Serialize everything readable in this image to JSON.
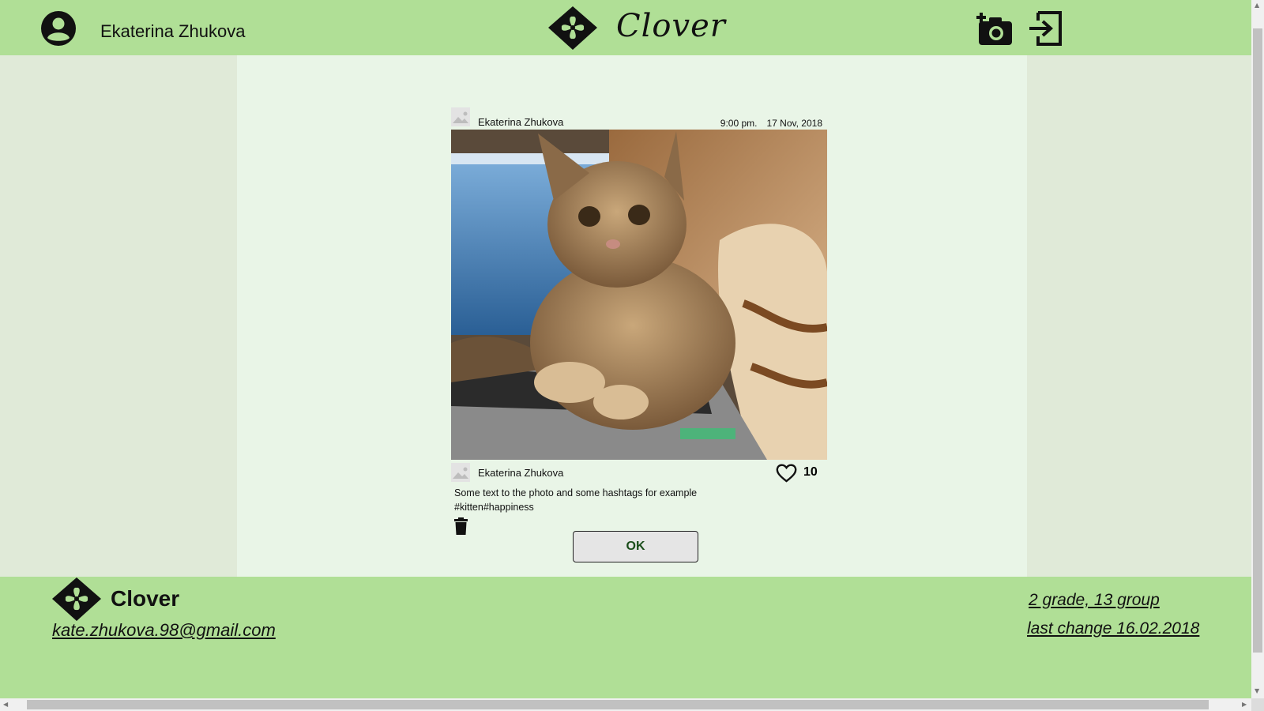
{
  "header": {
    "user_name": "Ekaterina Zhukova",
    "app_title": "Clover"
  },
  "post": {
    "author": "Ekaterina Zhukova",
    "time": "9:00 pm.",
    "date": "17 Nov, 2018",
    "likes": "10",
    "caption_line1": "Some text to the photo and some hashtags for example",
    "caption_line2": "#kitten#happiness",
    "ok_label": "OK"
  },
  "footer": {
    "brand": "Clover",
    "email": "kate.zhukova.98@gmail.com",
    "grade": "2 grade, 13 group",
    "last_change": "last change 16.02.2018"
  },
  "colors": {
    "header_bg": "#b0df96",
    "content_bg": "#e9f5e7",
    "side_bg": "#e0ead8"
  },
  "icons": {
    "user": "account-circle-icon",
    "logo": "clover-diamond-icon",
    "add_photo": "add-photo-camera-icon",
    "logout": "logout-icon",
    "like": "heart-icon",
    "delete": "trash-icon"
  }
}
